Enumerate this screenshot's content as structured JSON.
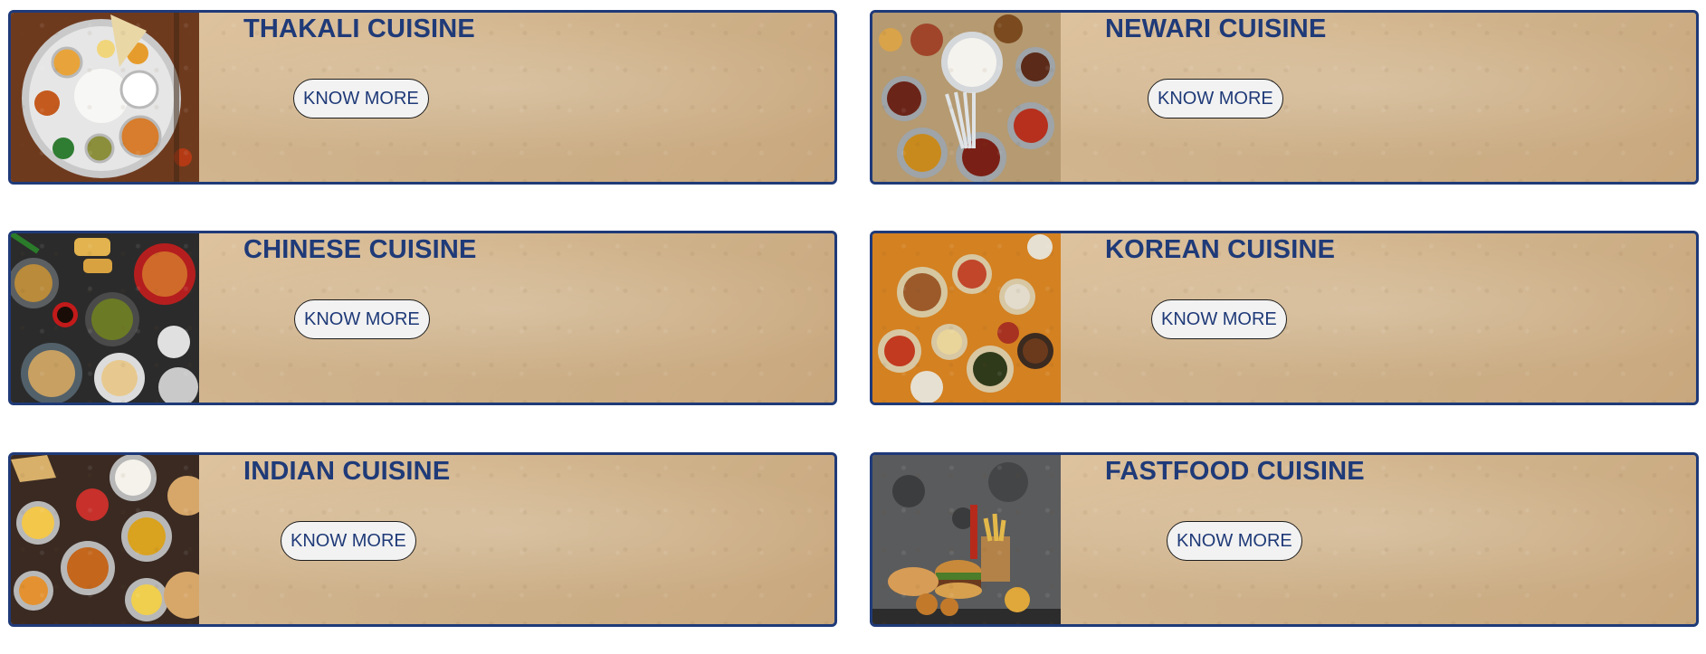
{
  "cards": [
    {
      "title": "THAKALI CUISINE",
      "button_label": "KNOW MORE",
      "image_icon": "thakali-food-photo"
    },
    {
      "title": "NEWARI CUISINE",
      "button_label": "KNOW MORE",
      "image_icon": "newari-food-photo"
    },
    {
      "title": "CHINESE CUISINE",
      "button_label": "KNOW MORE",
      "image_icon": "chinese-food-photo"
    },
    {
      "title": "KOREAN CUISINE",
      "button_label": "KNOW MORE",
      "image_icon": "korean-food-photo"
    },
    {
      "title": "INDIAN CUISINE",
      "button_label": "KNOW MORE",
      "image_icon": "indian-food-photo"
    },
    {
      "title": "FASTFOOD CUISINE",
      "button_label": "KNOW MORE",
      "image_icon": "fastfood-food-photo"
    }
  ],
  "colors": {
    "accent": "#1f3a78",
    "card_paper": "#d9bd97",
    "button_bg": "#f2f2f2"
  }
}
